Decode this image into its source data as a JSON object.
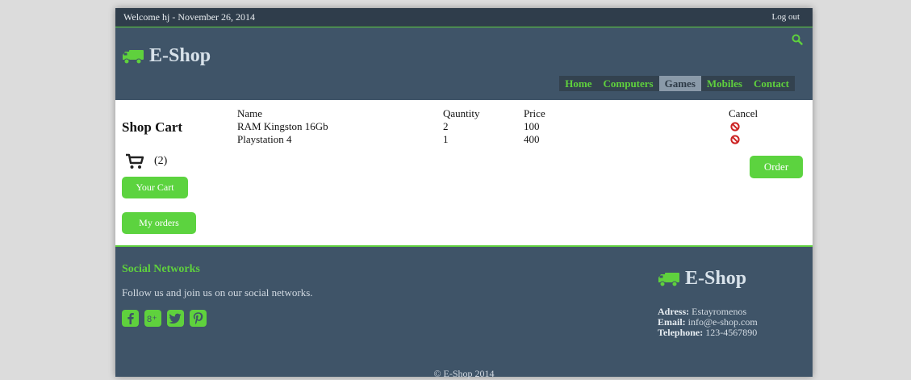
{
  "topbar": {
    "welcome": "Welcome hj -  November 26, 2014",
    "logout": "Log out"
  },
  "header": {
    "logo_text": "E-Shop",
    "nav": [
      {
        "label": "Home",
        "active": false
      },
      {
        "label": "Computers",
        "active": false
      },
      {
        "label": "Games",
        "active": true
      },
      {
        "label": "Mobiles",
        "active": false
      },
      {
        "label": "Contact",
        "active": false
      }
    ]
  },
  "sidebar": {
    "title": "Shop Cart",
    "cart_count": "(2)",
    "your_cart_button": "Your Cart",
    "my_orders_button": "My orders"
  },
  "cart": {
    "headers": {
      "name": "Name",
      "quantity": "Qauntity",
      "price": "Price",
      "cancel": "Cancel"
    },
    "rows": [
      {
        "name": "RAM Kingston 16Gb",
        "quantity": "2",
        "price": "100"
      },
      {
        "name": "Playstation 4",
        "quantity": "1",
        "price": "400"
      }
    ],
    "order_button": "Order"
  },
  "footer": {
    "social_title": "Social Networks",
    "social_text": "Follow us and join us on our social networks.",
    "social_icons": [
      "facebook-icon",
      "google-plus-icon",
      "twitter-icon",
      "pinterest-icon"
    ],
    "logo_text": "E-Shop",
    "address_label": "Adress:",
    "address_value": "Estayromenos",
    "email_label": "Email:",
    "email_value": "info@e-shop.com",
    "phone_label": "Telephone:",
    "phone_value": "123-4567890",
    "copyright": "© E-Shop 2014"
  },
  "colors": {
    "accent_green": "#5cd33f",
    "header_bg": "#3f5468",
    "topbar_bg": "#2f3d4b",
    "cancel_red": "#cc2222"
  }
}
